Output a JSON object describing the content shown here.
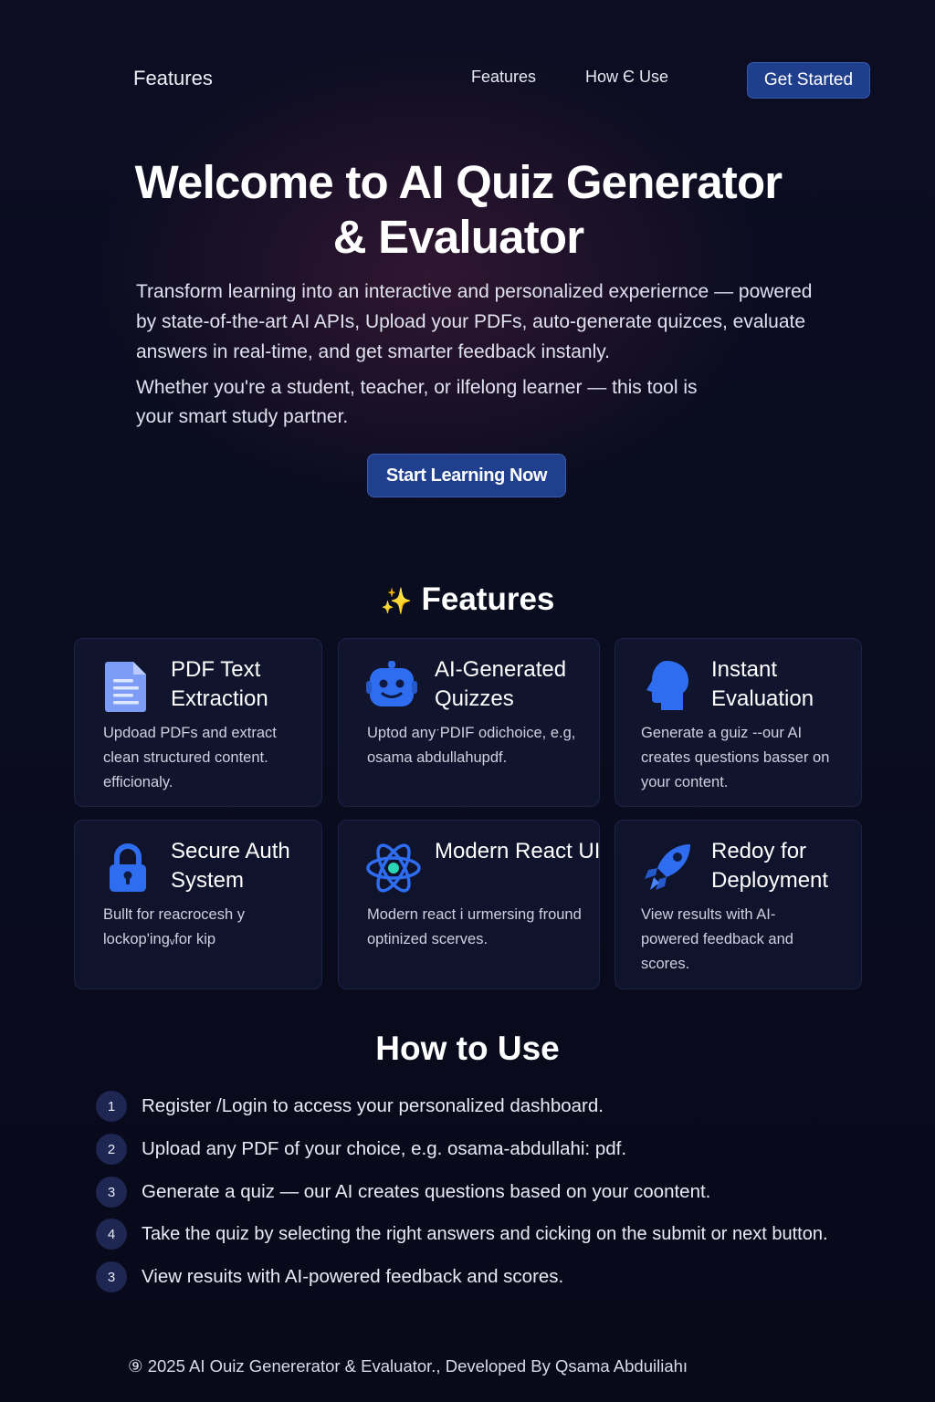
{
  "nav": {
    "brand": "Features",
    "links": [
      "Features",
      "How Є Use"
    ],
    "cta": "Get Started"
  },
  "hero": {
    "title_line1": "Welcome to AI Quiz Generator",
    "title_line2": "& Evaluator",
    "paragraph1": "Transform learning into an interactive and personalized experiernce — powered by state-of-the-art AI APIs, Upload your PDFs, auto-generate quizces, evaluate answers in real-time, and get smarter feedback instanly.",
    "paragraph2": "Whether you're a student, teacher, or ilfelong learner — this tool is your smart study partner.",
    "cta": "Start Learning Now"
  },
  "features": {
    "title": "Features",
    "cards": [
      {
        "title": "PDF Text Extraction",
        "desc": "Updoad PDFs and extract clean structured content. efficionaly.",
        "icon": "document-icon",
        "color": "#6f8ff0"
      },
      {
        "title": "AI-Generated Quizzes",
        "desc": "Uptod anyˑPDIF odichoice, e.g, osama abdullahupdf.",
        "icon": "robot-icon",
        "color": "#2f6df0"
      },
      {
        "title": "Instant Evaluation",
        "desc": "Generate a guiz --our AI creates questions basser on your content.",
        "icon": "head-icon",
        "color": "#2f6df0"
      },
      {
        "title": "Secure Auth System",
        "desc": "Bullt for reacrocesh y lockop'ingᵥfor kip",
        "icon": "padlock-icon",
        "color": "#2f6df0"
      },
      {
        "title": "Modern React UI",
        "desc": "Modern react i urmersing fround optinized scerves.",
        "icon": "react-atom-icon",
        "color": "#2f6df0"
      },
      {
        "title": "Redoy for Deployment",
        "desc": "View results with AI-powered feedback and scores.",
        "icon": "rocket-icon",
        "color": "#2f6df0"
      }
    ]
  },
  "howto": {
    "title": "How to Use",
    "steps": [
      {
        "num": "1",
        "text": "Register /Login to access your personalized dashboard."
      },
      {
        "num": "2",
        "text": "Upload any PDF of your choice, e.g. osama-abdullahi: pdf."
      },
      {
        "num": "3",
        "text": "Generate a quiz — our AI creates questions based on your coontent."
      },
      {
        "num": "4",
        "text": "Take the quiz by selecting the right answers and cicking on the submit or next button."
      },
      {
        "num": "3",
        "text": "View resuits with AI-powered feedback and scores."
      }
    ]
  },
  "footer": {
    "text": "⑨ 2025 AI Ouiz Genererator & Evaluator., Developed By Qsama Abduiliahı"
  }
}
